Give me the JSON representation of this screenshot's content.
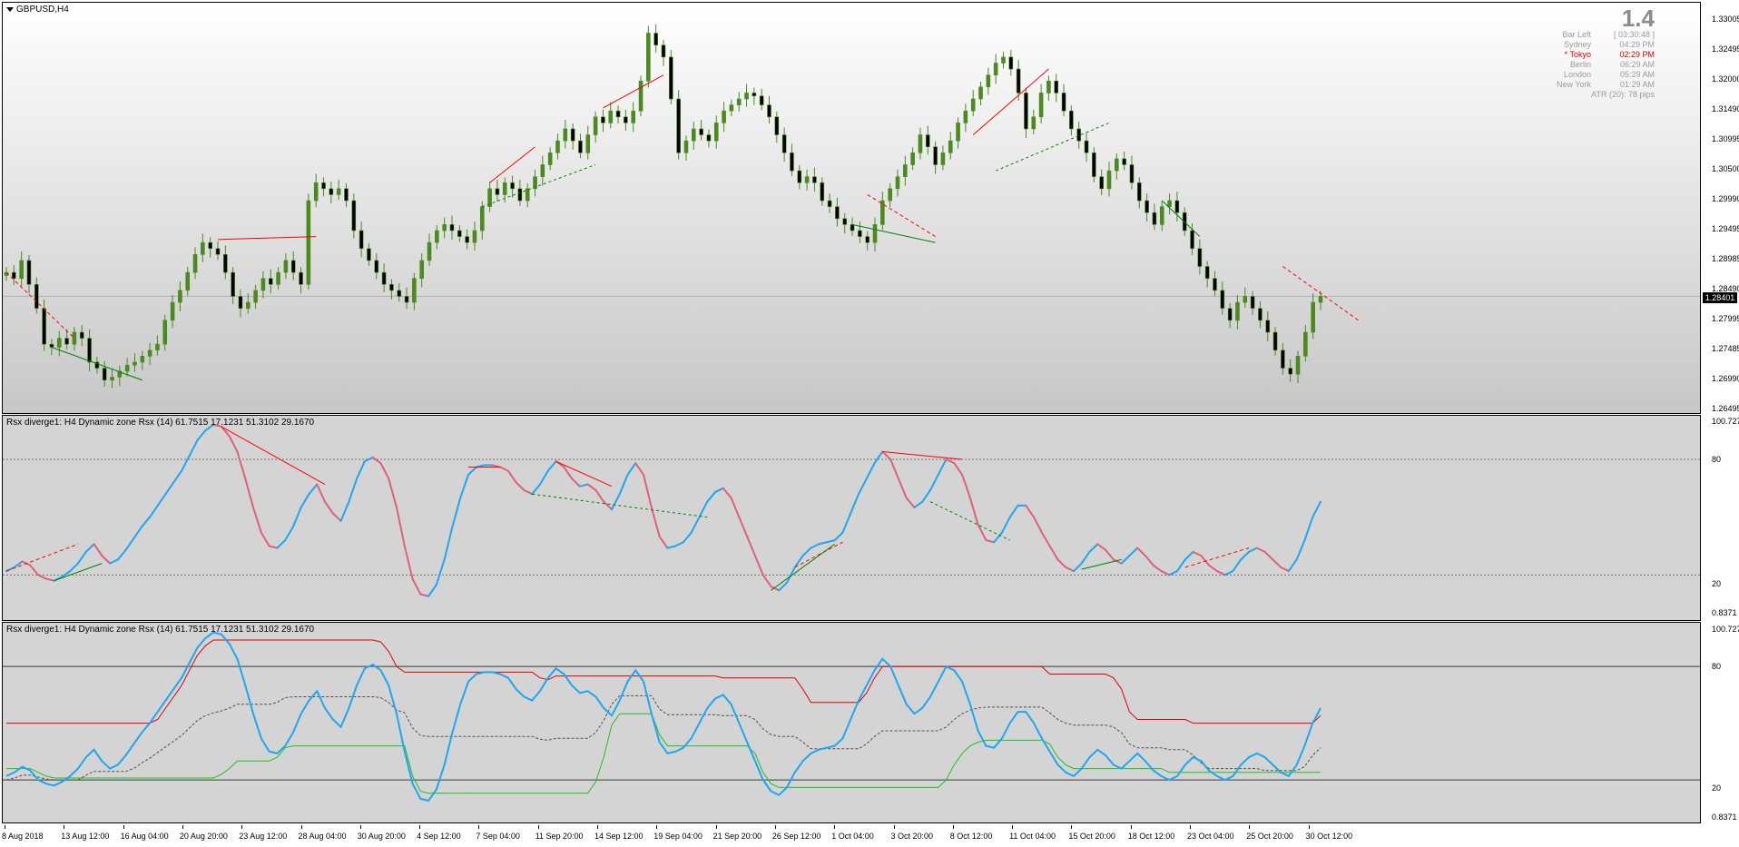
{
  "main": {
    "symbol": "GBPUSD,H4",
    "price_labels": [
      "1.33005",
      "1.32495",
      "1.32000",
      "1.31490",
      "1.30995",
      "1.30500",
      "1.29990",
      "1.29495",
      "1.28985",
      "1.28490",
      "1.27995",
      "1.27485",
      "1.26990",
      "1.26495"
    ],
    "current_price": "1.28401",
    "info": {
      "big_number": "1.4",
      "rows": [
        {
          "label": "Bar Left",
          "value": "[ 03:30:48 ]",
          "highlight": false
        },
        {
          "label": "Sydney",
          "value": "04:29 PM",
          "highlight": false
        },
        {
          "label": "* Tokyo",
          "value": "02:29 PM",
          "highlight": true
        },
        {
          "label": "Berlin",
          "value": "06:29 AM",
          "highlight": false
        },
        {
          "label": "London",
          "value": "05:29 AM",
          "highlight": false
        },
        {
          "label": "New York",
          "value": "01:29 AM",
          "highlight": false
        }
      ],
      "atr": "ATR (20): 78 pips"
    },
    "colors": {
      "bull": "#4a8a1e",
      "bear": "#000000",
      "up_div": "#ff0000",
      "down_div": "#008000"
    }
  },
  "ind1": {
    "title": "Rsx diverge1: H4  Dynamic zone Rsx (14) 61.7515 17.1231 51.3102 29.1670",
    "axis_labels": [
      "100.7279",
      "80",
      "20",
      "0.8371"
    ],
    "colors": {
      "rising": "#1ea7f0",
      "falling": "#e0607a"
    }
  },
  "ind2": {
    "title": "Rsx diverge1: H4  Dynamic zone Rsx (14) 61.7515 17.1231 51.3102 29.1670",
    "axis_labels": [
      "100.7279",
      "80",
      "20",
      "0.8371"
    ],
    "colors": {
      "rsx": "#1ea7f0",
      "upper": "#e00000",
      "lower": "#20c020",
      "mid": "#505050"
    }
  },
  "time_axis": [
    "8 Aug 2018",
    "13 Aug 12:00",
    "16 Aug 04:00",
    "20 Aug 20:00",
    "23 Aug 12:00",
    "28 Aug 04:00",
    "30 Aug 20:00",
    "4 Sep 12:00",
    "7 Sep 04:00",
    "11 Sep 20:00",
    "14 Sep 12:00",
    "19 Sep 04:00",
    "21 Sep 20:00",
    "26 Sep 12:00",
    "1 Oct 04:00",
    "3 Oct 20:00",
    "8 Oct 12:00",
    "11 Oct 04:00",
    "15 Oct 20:00",
    "18 Oct 12:00",
    "23 Oct 04:00",
    "25 Oct 20:00",
    "30 Oct 12:00"
  ],
  "price_series": [
    1.288,
    1.287,
    1.29,
    1.286,
    1.282,
    1.276,
    1.2755,
    1.277,
    1.276,
    1.278,
    1.277,
    1.273,
    1.272,
    1.27,
    1.2705,
    1.2715,
    1.2725,
    1.273,
    1.274,
    1.275,
    1.276,
    1.28,
    1.283,
    1.285,
    1.288,
    1.291,
    1.293,
    1.292,
    1.291,
    1.288,
    1.284,
    1.282,
    1.283,
    1.285,
    1.287,
    1.286,
    1.288,
    1.29,
    1.288,
    1.286,
    1.3,
    1.303,
    1.302,
    1.301,
    1.302,
    1.3,
    1.295,
    1.292,
    1.29,
    1.288,
    1.286,
    1.285,
    1.284,
    1.283,
    1.287,
    1.29,
    1.293,
    1.295,
    1.296,
    1.295,
    1.294,
    1.293,
    1.295,
    1.299,
    1.302,
    1.301,
    1.303,
    1.302,
    1.3,
    1.302,
    1.304,
    1.306,
    1.308,
    1.31,
    1.312,
    1.31,
    1.308,
    1.311,
    1.314,
    1.313,
    1.315,
    1.314,
    1.313,
    1.315,
    1.32,
    1.328,
    1.326,
    1.324,
    1.317,
    1.308,
    1.31,
    1.312,
    1.311,
    1.31,
    1.313,
    1.315,
    1.316,
    1.317,
    1.318,
    1.3175,
    1.316,
    1.314,
    1.311,
    1.308,
    1.305,
    1.303,
    1.304,
    1.303,
    1.3,
    1.299,
    1.297,
    1.296,
    1.295,
    1.294,
    1.293,
    1.296,
    1.3,
    1.302,
    1.304,
    1.306,
    1.308,
    1.311,
    1.309,
    1.306,
    1.308,
    1.31,
    1.313,
    1.315,
    1.317,
    1.319,
    1.321,
    1.323,
    1.324,
    1.322,
    1.318,
    1.312,
    1.314,
    1.318,
    1.32,
    1.318,
    1.315,
    1.312,
    1.31,
    1.308,
    1.304,
    1.302,
    1.305,
    1.307,
    1.306,
    1.303,
    1.3,
    1.298,
    1.296,
    1.299,
    1.3,
    1.298,
    1.295,
    1.292,
    1.289,
    1.287,
    1.285,
    1.282,
    1.28,
    1.283,
    1.284,
    1.282,
    1.28,
    1.278,
    1.275,
    1.272,
    1.271,
    1.274,
    1.278,
    1.283,
    1.284
  ],
  "rsx_series": [
    22,
    24,
    27,
    25,
    20,
    18,
    17,
    19,
    22,
    26,
    32,
    36,
    30,
    26,
    28,
    33,
    39,
    45,
    50,
    56,
    62,
    68,
    74,
    82,
    90,
    95,
    98,
    97,
    92,
    84,
    70,
    55,
    42,
    35,
    34,
    38,
    45,
    55,
    62,
    67,
    58,
    52,
    48,
    58,
    70,
    79,
    81,
    78,
    70,
    55,
    35,
    18,
    10,
    9,
    15,
    28,
    45,
    60,
    72,
    76,
    77,
    77,
    76,
    74,
    68,
    64,
    62,
    67,
    74,
    79,
    76,
    70,
    66,
    67,
    64,
    58,
    54,
    62,
    72,
    78,
    72,
    55,
    40,
    34,
    35,
    37,
    42,
    50,
    58,
    63,
    65,
    60,
    50,
    40,
    30,
    20,
    14,
    12,
    16,
    24,
    30,
    34,
    36,
    37,
    38,
    42,
    52,
    62,
    70,
    78,
    84,
    80,
    70,
    60,
    55,
    58,
    64,
    72,
    80,
    78,
    72,
    60,
    46,
    38,
    37,
    42,
    50,
    56,
    56,
    50,
    42,
    35,
    28,
    24,
    22,
    26,
    32,
    36,
    33,
    28,
    26,
    30,
    34,
    30,
    25,
    22,
    20,
    22,
    28,
    32,
    30,
    25,
    22,
    20,
    22,
    28,
    32,
    34,
    32,
    28,
    24,
    22,
    28,
    38,
    50,
    58
  ]
}
